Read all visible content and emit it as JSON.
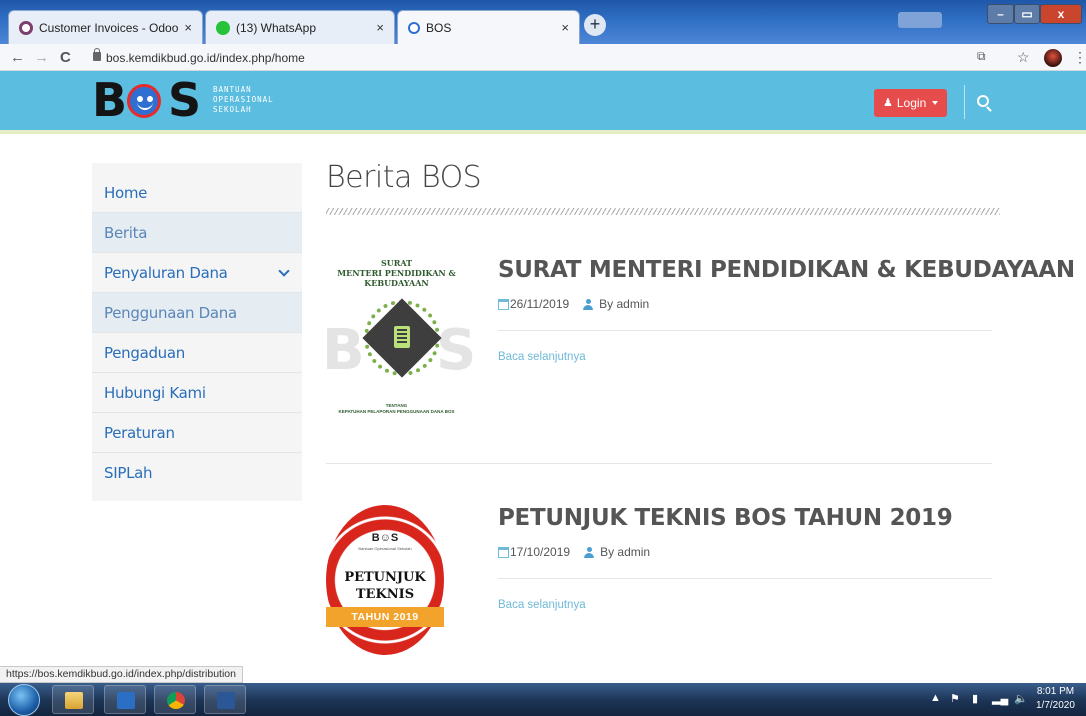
{
  "browser": {
    "tabs": [
      {
        "title": "Customer Invoices - Odoo",
        "close": "×"
      },
      {
        "title": "(13) WhatsApp",
        "close": "×",
        "badge": "13"
      },
      {
        "title": "BOS",
        "close": "×"
      }
    ],
    "new_tab": "+",
    "window_controls": [
      "–",
      "▭",
      "x"
    ],
    "url": "bos.kemdikbud.go.id/index.php/home",
    "nav": {
      "back": "←",
      "forward": "→",
      "reload": "C"
    },
    "toolbar_icons": [
      "translate-icon",
      "star-icon",
      "profile-avatar",
      "menu-icon"
    ],
    "status_url": "https://bos.kemdikbud.go.id/index.php/distribution"
  },
  "site": {
    "logo": {
      "b": "B",
      "s": "S",
      "lines": [
        "BANTUAN",
        "OPERASIONAL",
        "SEKOLAH"
      ]
    },
    "login_label": "Login",
    "colors": {
      "header": "#5bbde0",
      "login": "#e74c4c",
      "link": "#2a6ebb",
      "accent": "#6fbad8"
    }
  },
  "sidebar": {
    "items": [
      {
        "label": "Home"
      },
      {
        "label": "Berita"
      },
      {
        "label": "Penyaluran Dana"
      },
      {
        "label": "Penggunaan Dana"
      },
      {
        "label": "Pengaduan"
      },
      {
        "label": "Hubungi Kami"
      },
      {
        "label": "Peraturan"
      },
      {
        "label": "SIPLah"
      }
    ]
  },
  "main": {
    "page_title": "Berita BOS",
    "posts": [
      {
        "title": "SURAT MENTERI PENDIDIKAN & KEBUDAYAAN",
        "date": "26/11/2019",
        "author": "By admin",
        "read_more": "Baca selanjutnya",
        "thumb": {
          "heading": [
            "SURAT",
            "MENTERI PENDIDIKAN &",
            "KEBUDAYAAN"
          ],
          "bg_b": "B",
          "bg_s": "S",
          "sub": [
            "TENTANG",
            "KEPATUHAN PELAPORAN PENGGUNAAN DANA BOS"
          ]
        }
      },
      {
        "title": "PETUNJUK TEKNIS BOS TAHUN 2019",
        "date": "17/10/2019",
        "author": "By admin",
        "read_more": "Baca selanjutnya",
        "thumb": {
          "logo": "B☺S",
          "tagline": "Bantuan Operasional Sekolah",
          "line1": "PETUNJUK",
          "line2": "TEKNIS",
          "ribbon": "TAHUN 2019"
        }
      }
    ]
  },
  "taskbar": {
    "apps": [
      "file-explorer-icon",
      "media-player-icon",
      "chrome-icon",
      "word-icon"
    ],
    "time": "8:01 PM",
    "date": "1/7/2020"
  }
}
